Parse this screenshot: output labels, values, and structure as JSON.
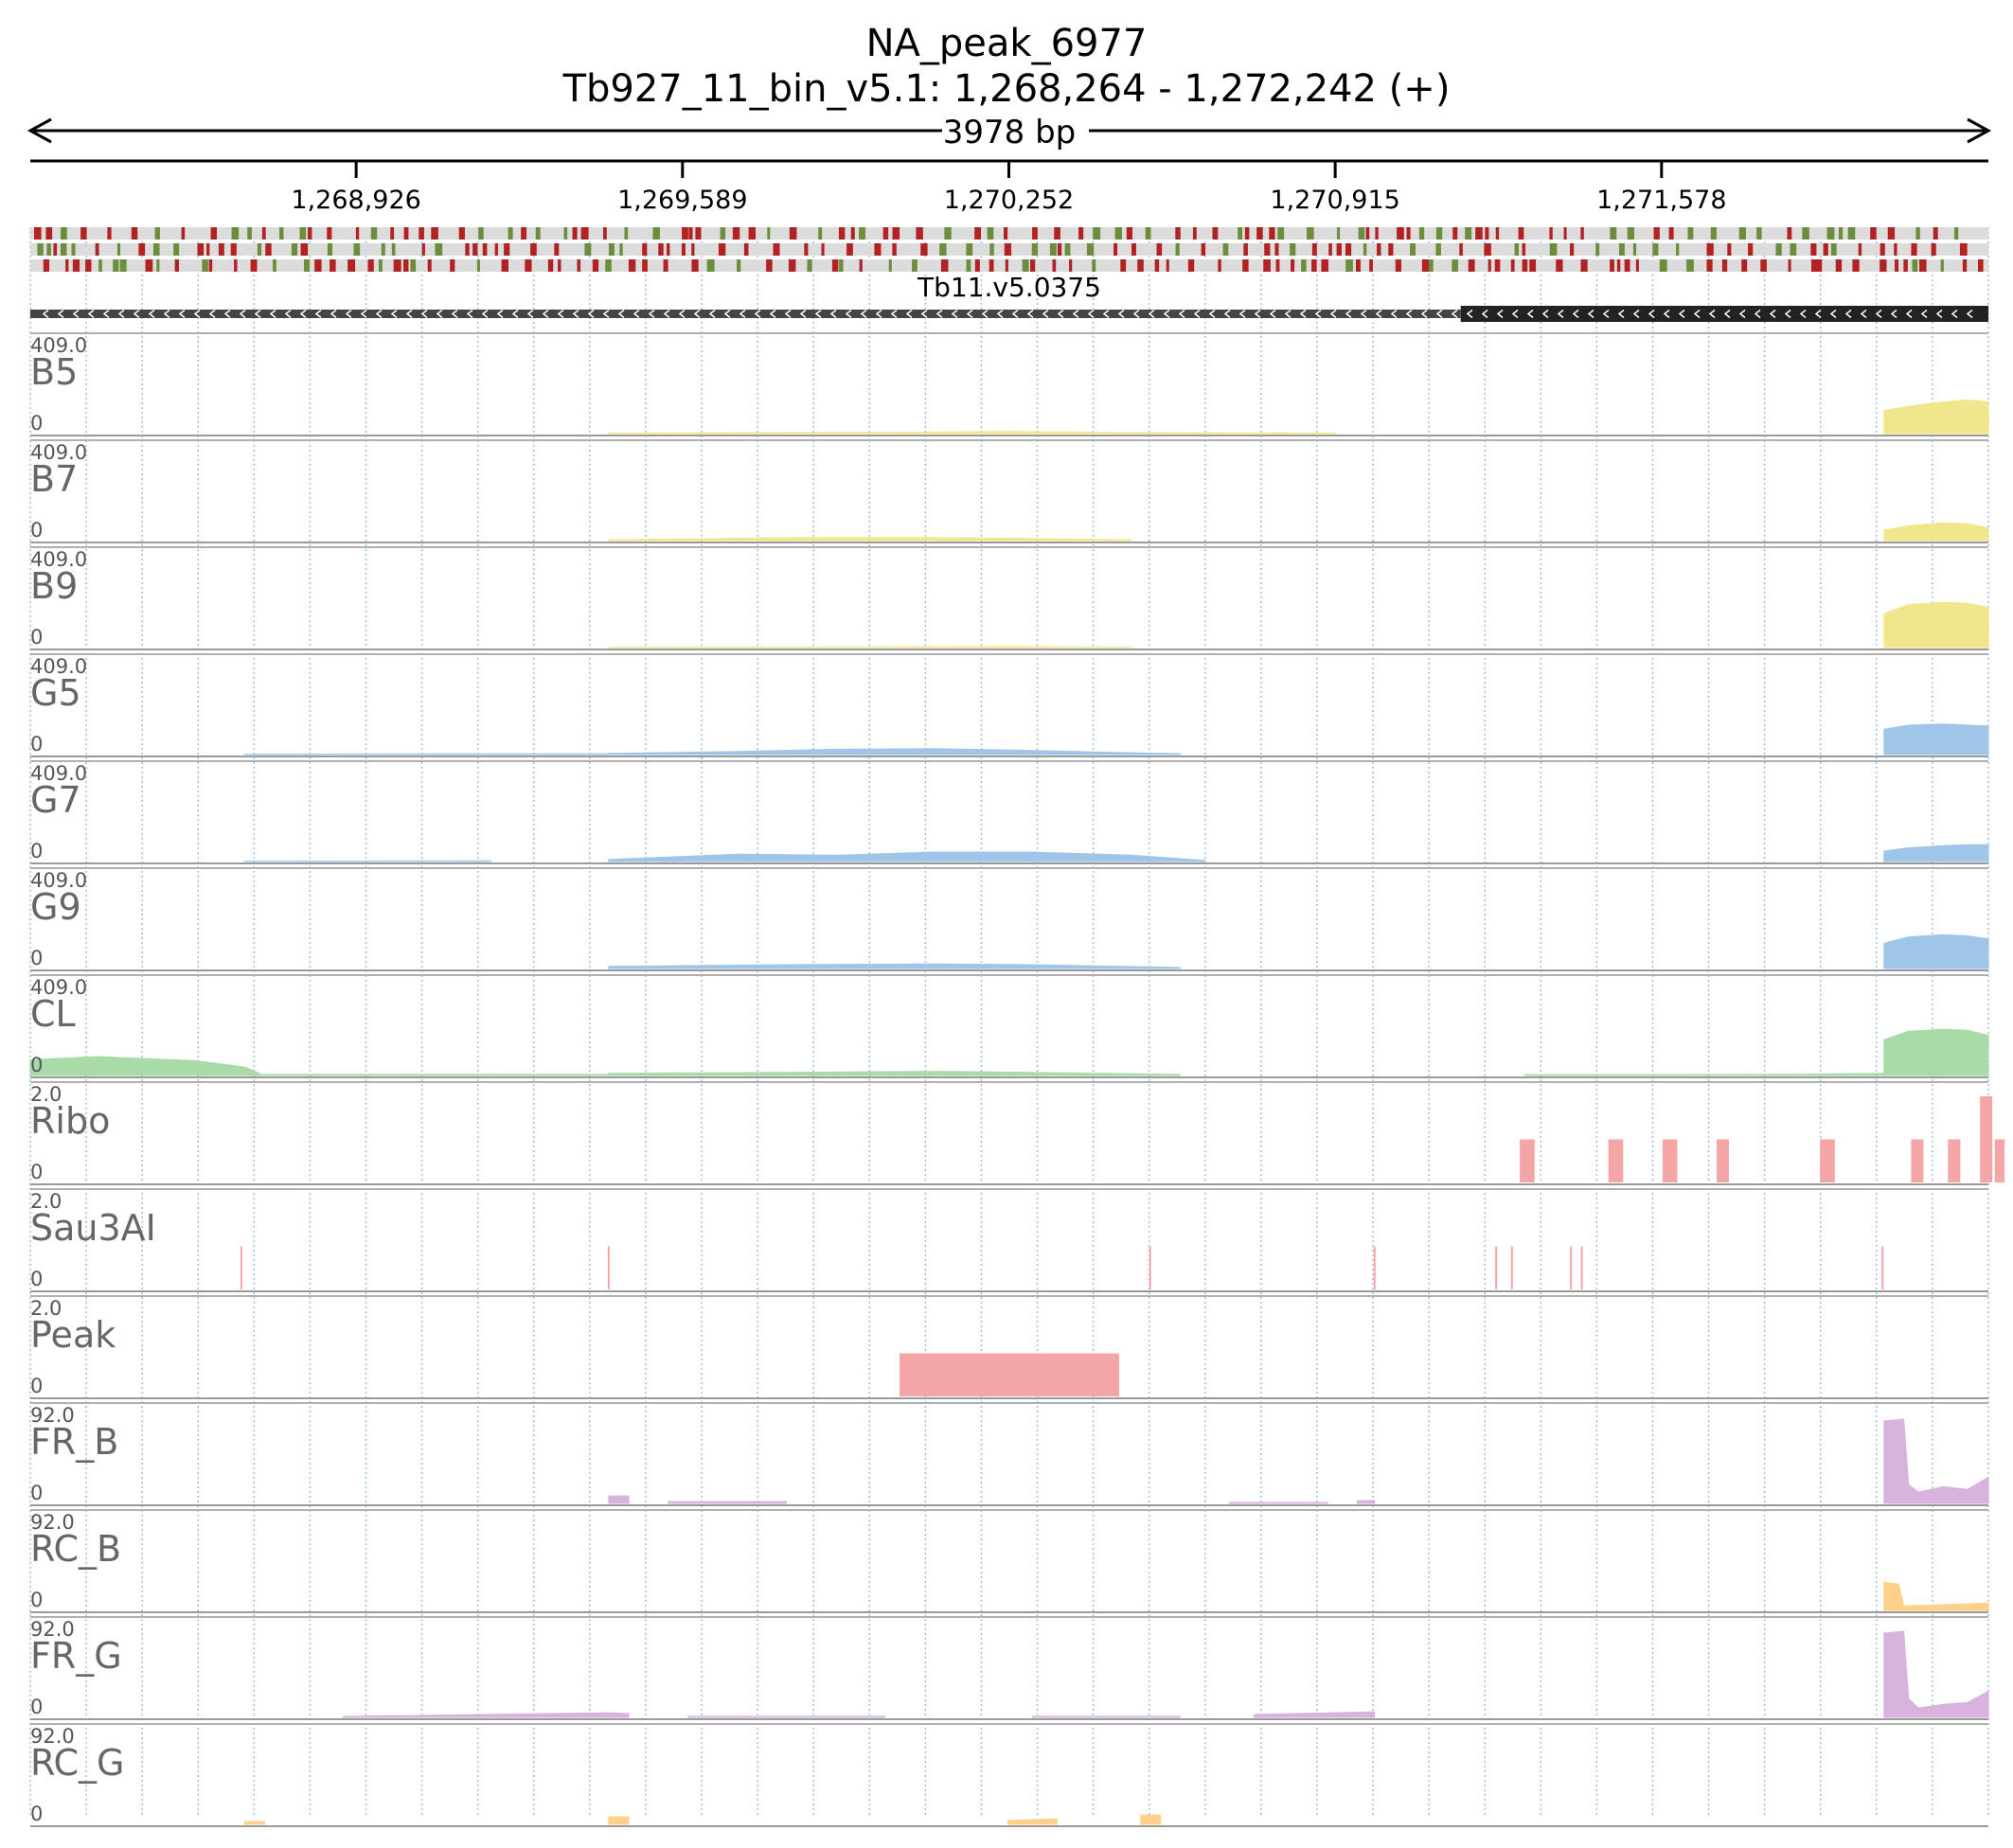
{
  "chart_data": {
    "type": "area",
    "title": "NA_peak_6977",
    "region": "Tb927_11_bin_v5.1: 1,268,264 - 1,272,242 (+)",
    "span_label": "3978 bp",
    "xlim": [
      1268264,
      1272242
    ],
    "x_ticks": [
      1268926,
      1269589,
      1270252,
      1270915,
      1271578
    ],
    "x_tick_labels": [
      "1,268,926",
      "1,269,589",
      "1,270,252",
      "1,270,915",
      "1,271,578"
    ],
    "gene": {
      "name": "Tb11.v5.0375",
      "strand": "-",
      "utr": [
        1268264,
        1271170
      ],
      "cds": [
        1271170,
        1272242
      ]
    },
    "tracks": [
      {
        "name": "B5",
        "ymax_label": "409.0",
        "ymin_label": "0",
        "ymax": 409,
        "color": "#f0e68c",
        "segments": [
          {
            "x": [
              1269439,
              1269750,
              1270000,
              1270252,
              1270400,
              1270466,
              1270915
            ],
            "y": [
              3,
              5,
              6,
              10,
              7,
              5,
              3
            ]
          },
          {
            "x": [
              1272030,
              1272080,
              1272150,
              1272200,
              1272242
            ],
            "y": [
              110,
              130,
              150,
              160,
              150
            ]
          }
        ]
      },
      {
        "name": "B7",
        "ymax_label": "409.0",
        "ymin_label": "0",
        "ymax": 409,
        "color": "#f0e68c",
        "segments": [
          {
            "x": [
              1269439,
              1269589,
              1269800,
              1270100,
              1270300,
              1270500
            ],
            "y": [
              4,
              8,
              14,
              14,
              10,
              4
            ]
          },
          {
            "x": [
              1272030,
              1272080,
              1272150,
              1272200,
              1272242
            ],
            "y": [
              50,
              70,
              85,
              80,
              60
            ]
          }
        ]
      },
      {
        "name": "B9",
        "ymax_label": "409.0",
        "ymin_label": "0",
        "ymax": 409,
        "color": "#f0e68c",
        "segments": [
          {
            "x": [
              1269439,
              1270000,
              1270252,
              1270500
            ],
            "y": [
              2,
              3,
              5,
              2
            ]
          },
          {
            "x": [
              1272030,
              1272080,
              1272150,
              1272200,
              1272242
            ],
            "y": [
              160,
              205,
              215,
              210,
              190
            ]
          }
        ]
      },
      {
        "name": "G5",
        "ymax_label": "409.0",
        "ymin_label": "0",
        "ymax": 409,
        "color": "#9fc5e8",
        "segments": [
          {
            "x": [
              1268700,
              1269100,
              1269439
            ],
            "y": [
              2,
              3,
              3
            ]
          },
          {
            "x": [
              1269439,
              1269700,
              1269900,
              1270100,
              1270300,
              1270466,
              1270600
            ],
            "y": [
              5,
              15,
              25,
              28,
              20,
              10,
              4
            ]
          },
          {
            "x": [
              1272030,
              1272080,
              1272150,
              1272200,
              1272242
            ],
            "y": [
              120,
              140,
              145,
              140,
              135
            ]
          }
        ]
      },
      {
        "name": "G7",
        "ymax_label": "409.0",
        "ymin_label": "0",
        "ymax": 409,
        "color": "#9fc5e8",
        "segments": [
          {
            "x": [
              1268700,
              1269200
            ],
            "y": [
              2,
              3
            ]
          },
          {
            "x": [
              1269439,
              1269700,
              1269900,
              1270100,
              1270300,
              1270500,
              1270650
            ],
            "y": [
              10,
              35,
              30,
              45,
              45,
              30,
              5
            ]
          },
          {
            "x": [
              1272030,
              1272080,
              1272150,
              1272200,
              1272242
            ],
            "y": [
              50,
              65,
              75,
              80,
              80
            ]
          }
        ]
      },
      {
        "name": "G9",
        "ymax_label": "409.0",
        "ymin_label": "0",
        "ymax": 409,
        "color": "#9fc5e8",
        "segments": [
          {
            "x": [
              1269439,
              1269800,
              1270100,
              1270300,
              1270600
            ],
            "y": [
              10,
              18,
              22,
              18,
              5
            ]
          },
          {
            "x": [
              1272030,
              1272080,
              1272150,
              1272200,
              1272242
            ],
            "y": [
              120,
              150,
              160,
              155,
              140
            ]
          }
        ]
      },
      {
        "name": "CL",
        "ymax_label": "409.0",
        "ymin_label": "0",
        "ymax": 409,
        "color": "#a8dba8",
        "segments": [
          {
            "x": [
              1268264,
              1268400,
              1268600,
              1268700,
              1268730
            ],
            "y": [
              75,
              90,
              70,
              40,
              10
            ]
          },
          {
            "x": [
              1268730,
              1269000,
              1269200,
              1269439
            ],
            "y": [
              5,
              5,
              6,
              5
            ]
          },
          {
            "x": [
              1269439,
              1269800,
              1270100,
              1270300,
              1270600
            ],
            "y": [
              10,
              15,
              20,
              15,
              5
            ]
          },
          {
            "x": [
              1271300,
              1271800,
              1272030
            ],
            "y": [
              4,
              5,
              10
            ]
          },
          {
            "x": [
              1272030,
              1272080,
              1272150,
              1272200,
              1272242
            ],
            "y": [
              170,
              210,
              220,
              215,
              190
            ]
          }
        ]
      },
      {
        "name": "Ribo",
        "ymax_label": "2.0",
        "ymin_label": "0",
        "ymax": 2,
        "color": "#f4a5a5",
        "type": "bar",
        "bars": [
          {
            "x": [
              1271290,
              1271320
            ],
            "y": 1
          },
          {
            "x": [
              1271470,
              1271500
            ],
            "y": 1
          },
          {
            "x": [
              1271580,
              1271610
            ],
            "y": 1
          },
          {
            "x": [
              1271690,
              1271715
            ],
            "y": 1
          },
          {
            "x": [
              1271900,
              1271930
            ],
            "y": 1
          },
          {
            "x": [
              1272085,
              1272110
            ],
            "y": 1
          },
          {
            "x": [
              1272160,
              1272185
            ],
            "y": 1
          },
          {
            "x": [
              1272225,
              1272250
            ],
            "y": 2
          },
          {
            "x": [
              1272255,
              1272275
            ],
            "y": 1
          }
        ]
      },
      {
        "name": "Sau3AI",
        "ymax_label": "2.0",
        "ymin_label": "0",
        "ymax": 2,
        "color": "#f4a5a5",
        "type": "tick",
        "sites": [
          1268693,
          1269439,
          1270539,
          1270995,
          1271242,
          1271274,
          1271394,
          1271416,
          1272027
        ],
        "y": 1
      },
      {
        "name": "Peak",
        "ymax_label": "2.0",
        "ymin_label": "0",
        "ymax": 2,
        "color": "#f4a5a5",
        "type": "bar",
        "bars": [
          {
            "x": [
              1270030,
              1270476
            ],
            "y": 1
          }
        ]
      },
      {
        "name": "FR_B",
        "ymax_label": "92.0",
        "ymin_label": "0",
        "ymax": 92,
        "color": "#d7b3dd",
        "segments": [
          {
            "x": [
              1269439,
              1269480
            ],
            "y": [
              8,
              8
            ]
          },
          {
            "x": [
              1269560,
              1269800
            ],
            "y": [
              2,
              2
            ]
          },
          {
            "x": [
              1270700,
              1270900
            ],
            "y": [
              1,
              1
            ]
          },
          {
            "x": [
              1270960,
              1270995
            ],
            "y": [
              3,
              3
            ]
          },
          {
            "x": [
              1272030,
              1272070,
              1272080,
              1272100,
              1272150,
              1272200,
              1272242
            ],
            "y": [
              88,
              90,
              20,
              12,
              18,
              15,
              28
            ]
          }
        ]
      },
      {
        "name": "RC_B",
        "ymax_label": "92.0",
        "ymin_label": "0",
        "ymax": 92,
        "color": "#ffd08a",
        "segments": [
          {
            "x": [
              1272030,
              1272060,
              1272070,
              1272150,
              1272242
            ],
            "y": [
              30,
              28,
              5,
              6,
              8
            ]
          }
        ]
      },
      {
        "name": "FR_G",
        "ymax_label": "92.0",
        "ymin_label": "0",
        "ymax": 92,
        "color": "#d7b3dd",
        "segments": [
          {
            "x": [
              1268900,
              1269439,
              1269480
            ],
            "y": [
              1,
              5,
              4
            ]
          },
          {
            "x": [
              1269600,
              1270000
            ],
            "y": [
              1,
              1
            ]
          },
          {
            "x": [
              1270300,
              1270600
            ],
            "y": [
              1,
              1
            ]
          },
          {
            "x": [
              1270750,
              1270995
            ],
            "y": [
              3,
              6
            ]
          },
          {
            "x": [
              1272030,
              1272070,
              1272080,
              1272100,
              1272150,
              1272200,
              1272242
            ],
            "y": [
              90,
              92,
              20,
              10,
              14,
              16,
              28
            ]
          }
        ]
      },
      {
        "name": "RC_G",
        "ymax_label": "92.0",
        "ymin_label": "0",
        "ymax": 92,
        "color": "#ffd08a",
        "segments": [
          {
            "x": [
              1268700,
              1268740
            ],
            "y": [
              3,
              3
            ]
          },
          {
            "x": [
              1269439,
              1269480
            ],
            "y": [
              8,
              8
            ]
          },
          {
            "x": [
              1270250,
              1270350
            ],
            "y": [
              4,
              6
            ]
          },
          {
            "x": [
              1270520,
              1270560
            ],
            "y": [
              10,
              10
            ]
          }
        ]
      }
    ]
  }
}
